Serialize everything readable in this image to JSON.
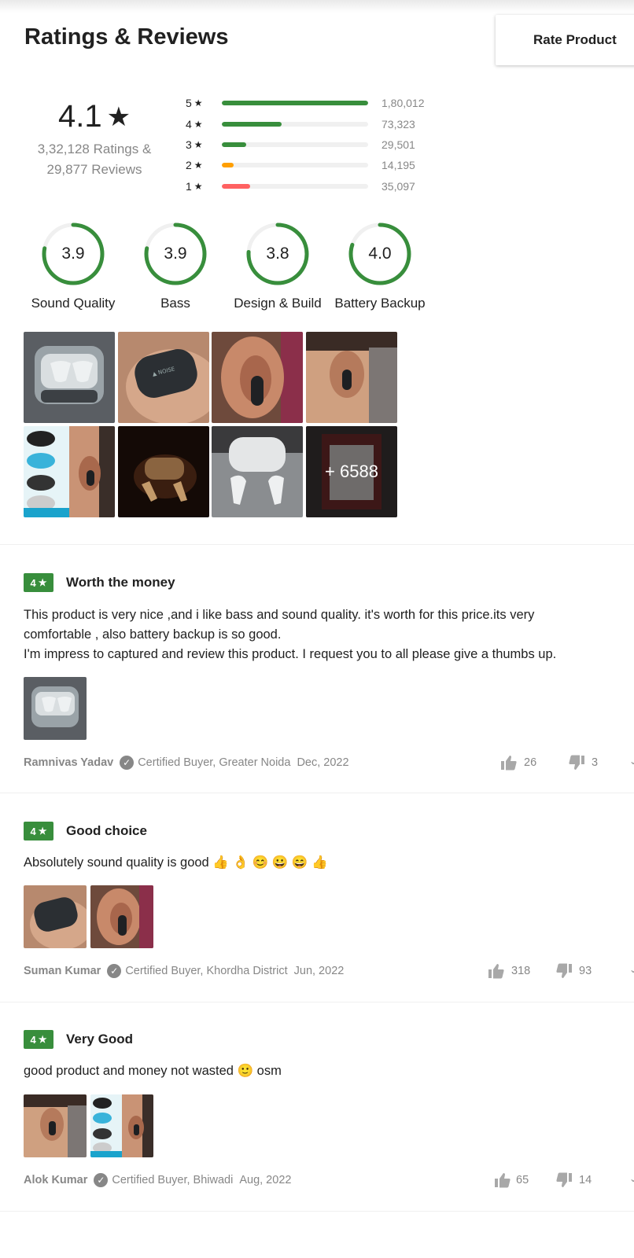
{
  "header": {
    "title": "Ratings & Reviews",
    "rate_button": "Rate Product"
  },
  "summary": {
    "score": "4.1",
    "star": "★",
    "ratings_line": "3,32,128 Ratings &",
    "reviews_line": "29,877 Reviews"
  },
  "distribution": [
    {
      "label": "5",
      "count": "1,80,012",
      "fraction": 1.0,
      "color": "#388e3c"
    },
    {
      "label": "4",
      "count": "73,323",
      "fraction": 0.407,
      "color": "#388e3c"
    },
    {
      "label": "3",
      "count": "29,501",
      "fraction": 0.164,
      "color": "#388e3c"
    },
    {
      "label": "2",
      "count": "14,195",
      "fraction": 0.079,
      "color": "#ff9f00"
    },
    {
      "label": "1",
      "count": "35,097",
      "fraction": 0.195,
      "color": "#ff6161"
    }
  ],
  "aspects": [
    {
      "name": "Sound Quality",
      "score": "3.9",
      "fraction": 0.78
    },
    {
      "name": "Bass",
      "score": "3.9",
      "fraction": 0.78
    },
    {
      "name": "Design & Build",
      "score": "3.8",
      "fraction": 0.76
    },
    {
      "name": "Battery Backup",
      "score": "4.0",
      "fraction": 0.8
    }
  ],
  "gallery": {
    "more_label": "+ 6588"
  },
  "reviews": [
    {
      "rating": "4",
      "title": "Worth the money",
      "text_lines": [
        "This product is very nice ,and i like bass and sound quality. it's worth for this price.its very",
        "comfortable , also battery backup is so good.",
        "I'm impress to captured and review this product. I request you to all please give a thumbs up."
      ],
      "author": "Ramnivas Yadav",
      "certified": "Certified Buyer, Greater Noida",
      "date": "Dec, 2022",
      "likes": "26",
      "dislikes": "3"
    },
    {
      "rating": "4",
      "title": "Good choice",
      "text_lines": [
        "Absolutely sound quality is good 👍 👌 😊 😀 😄 👍"
      ],
      "author": "Suman Kumar",
      "certified": "Certified Buyer, Khordha District",
      "date": "Jun, 2022",
      "likes": "318",
      "dislikes": "93"
    },
    {
      "rating": "4",
      "title": "Very Good",
      "text_lines": [
        "good product and money not wasted 🙂 osm"
      ],
      "author": "Alok Kumar",
      "certified": "Certified Buyer, Bhiwadi",
      "date": "Aug, 2022",
      "likes": "65",
      "dislikes": "14"
    }
  ],
  "icons": {
    "star": "star-icon",
    "check": "verified-check-icon",
    "like": "thumbs-up-icon",
    "dislike": "thumbs-down-icon"
  }
}
